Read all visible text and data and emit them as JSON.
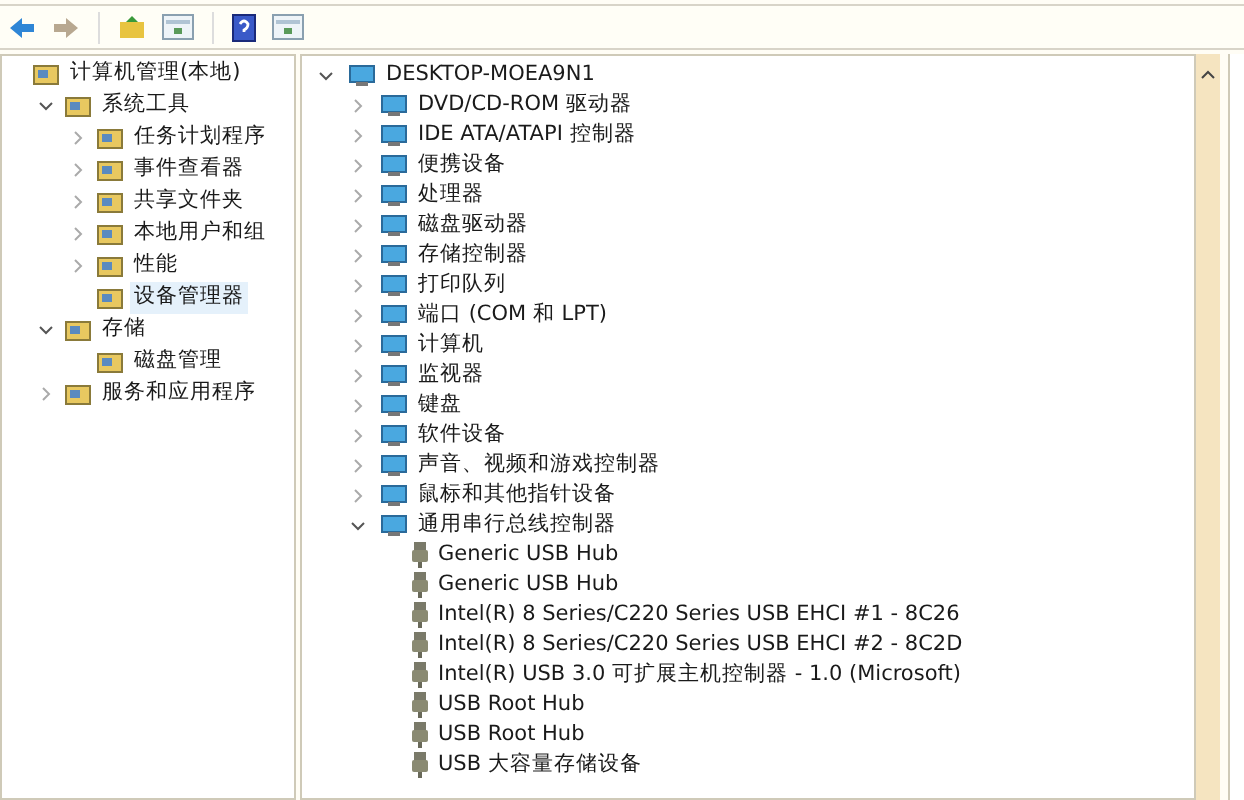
{
  "toolbar": {
    "buttons": [
      {
        "kind": "back"
      },
      {
        "kind": "forward"
      },
      {
        "kind": "up"
      },
      {
        "kind": "pane"
      },
      {
        "kind": "help"
      },
      {
        "kind": "pane"
      }
    ]
  },
  "console_tree": {
    "items": [
      {
        "label": "计算机管理(本地)",
        "selected": false,
        "children": [
          {
            "label": "系统工具",
            "selected": false,
            "expanded": true,
            "children": [
              {
                "label": "任务计划程序",
                "selected": false,
                "expanded": false
              },
              {
                "label": "事件查看器",
                "selected": false,
                "expanded": false
              },
              {
                "label": "共享文件夹",
                "selected": false,
                "expanded": false
              },
              {
                "label": "本地用户和组",
                "selected": false,
                "expanded": false
              },
              {
                "label": "性能",
                "selected": false,
                "expanded": false
              },
              {
                "label": "设备管理器",
                "selected": true
              }
            ]
          },
          {
            "label": "存储",
            "selected": false,
            "expanded": true,
            "children": [
              {
                "label": "磁盘管理",
                "selected": false
              }
            ]
          },
          {
            "label": "服务和应用程序",
            "selected": false,
            "expanded": false
          }
        ]
      }
    ]
  },
  "device_tree": {
    "items": [
      {
        "label": "DESKTOP-MOEA9N1",
        "expanded": true,
        "children": [
          {
            "label": "DVD/CD-ROM 驱动器",
            "expanded": false
          },
          {
            "label": "IDE ATA/ATAPI 控制器",
            "expanded": false
          },
          {
            "label": "便携设备",
            "expanded": false
          },
          {
            "label": "处理器",
            "expanded": false
          },
          {
            "label": "磁盘驱动器",
            "expanded": false
          },
          {
            "label": "存储控制器",
            "expanded": false
          },
          {
            "label": "打印队列",
            "expanded": false
          },
          {
            "label": "端口 (COM 和 LPT)",
            "expanded": false
          },
          {
            "label": "计算机",
            "expanded": false
          },
          {
            "label": "监视器",
            "expanded": false
          },
          {
            "label": "键盘",
            "expanded": false
          },
          {
            "label": "软件设备",
            "expanded": false
          },
          {
            "label": "声音、视频和游戏控制器",
            "expanded": false
          },
          {
            "label": "鼠标和其他指针设备",
            "expanded": false
          },
          {
            "label": "通用串行总线控制器",
            "expanded": true,
            "children": [
              {
                "label": "Generic USB Hub"
              },
              {
                "label": "Generic USB Hub"
              },
              {
                "label": "Intel(R) 8 Series/C220 Series USB EHCI #1 - 8C26"
              },
              {
                "label": "Intel(R) 8 Series/C220 Series USB EHCI #2 - 8C2D"
              },
              {
                "label": "Intel(R) USB 3.0 可扩展主机控制器 - 1.0 (Microsoft)"
              },
              {
                "label": "USB Root Hub"
              },
              {
                "label": "USB Root Hub"
              },
              {
                "label": "USB 大容量存储设备"
              }
            ]
          }
        ]
      }
    ]
  }
}
